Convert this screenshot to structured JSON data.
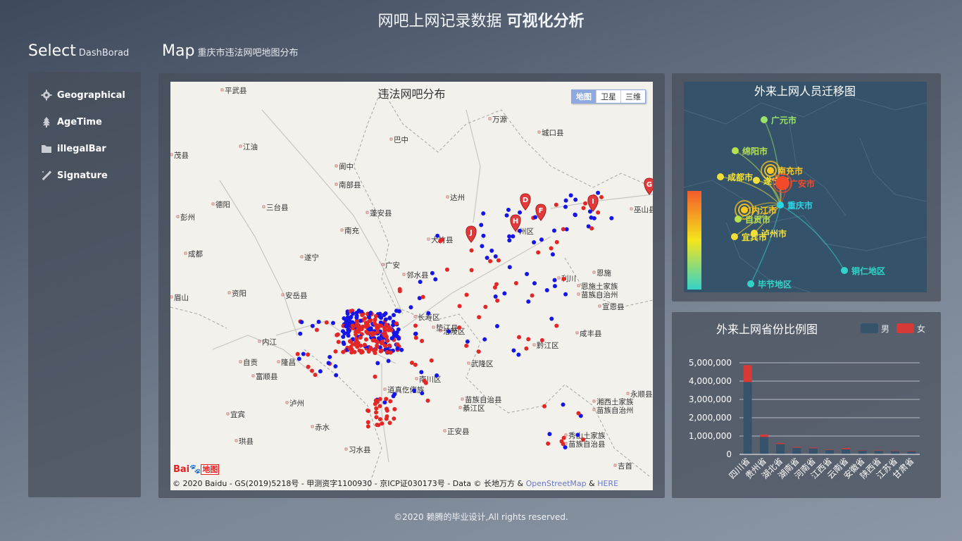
{
  "header": {
    "title_plain": "网吧上网记录数据",
    "title_bold": "可视化分析"
  },
  "sidebar": {
    "heading": "Select",
    "subheading": "DashBorad",
    "items": [
      {
        "label": "Geographical",
        "icon": "gear-icon"
      },
      {
        "label": "AgeTime",
        "icon": "tree-icon"
      },
      {
        "label": "illegalBar",
        "icon": "folder-icon"
      },
      {
        "label": "Signature",
        "icon": "magic-wand-icon"
      }
    ]
  },
  "map_section": {
    "heading": "Map",
    "subheading": "重庆市违法网吧地图分布",
    "map_title": "违法网吧分布",
    "map_types": [
      "地图",
      "卫星",
      "三维"
    ],
    "active_type": "地图",
    "logo_text": "Bai",
    "logo_suffix": "地图",
    "copyright": "© 2020 Baidu - GS(2019)5218号 - 甲测资字1100930 - 京ICP证030173号 - Data © 长地万方 &",
    "link_osm": "OpenStreetMap",
    "amp": "&",
    "link_here": "HERE",
    "place_labels": [
      "平武县",
      "茂县",
      "江油",
      "巴中",
      "万源",
      "城口县",
      "阆中",
      "南部县",
      "德阳",
      "三台县",
      "达州",
      "彭州",
      "蓬安县",
      "南充",
      "大竹县",
      "成都",
      "遂宁",
      "广安",
      "邻水县",
      "利川",
      "恩施",
      "巫山县",
      "资阳",
      "安岳县",
      "恩施土家族",
      "苗族自治州",
      "眉山",
      "宣恩县",
      "长寿区",
      "垫江县",
      "涪陵区",
      "咸丰县",
      "内江",
      "黔江区",
      "自贡",
      "隆昌",
      "富顺县",
      "武隆区",
      "南川区",
      "道真仡佬族",
      "苗族自治县",
      "綦江区",
      "泸州",
      "永顺县",
      "湘西土家族",
      "苗族自治州",
      "宜宾",
      "赤水",
      "正安县",
      "珙县",
      "秀山土家族",
      "苗族自治县",
      "习水县",
      "吉首",
      "州区"
    ],
    "markers": [
      "D",
      "F",
      "H",
      "I",
      "J",
      "G"
    ],
    "legend_colors": {
      "blue": "#1515e6",
      "red": "#e32626"
    }
  },
  "migration": {
    "title": "外来上网人员迁移图",
    "cities": [
      "广元市",
      "绵阳市",
      "成都市",
      "南充市",
      "遂宁市",
      "广安市",
      "内江市",
      "重庆市",
      "自贡市",
      "泸州市",
      "宜宾市",
      "铜仁地区",
      "毕节地区"
    ]
  },
  "province_chart": {
    "title": "外来上网省份比例图",
    "legend": [
      "男",
      "女"
    ],
    "colors": {
      "male": "#35536a",
      "female": "#d73a36"
    }
  },
  "chart_data": {
    "type": "bar",
    "stacked": true,
    "categories": [
      "四川省",
      "贵州省",
      "湖北省",
      "湖南省",
      "河南省",
      "江西省",
      "云南省",
      "安徽省",
      "陕西省",
      "江苏省",
      "甘肃省"
    ],
    "series": [
      {
        "name": "男",
        "values": [
          3950000,
          950000,
          560000,
          360000,
          330000,
          240000,
          280000,
          210000,
          200000,
          180000,
          170000
        ]
      },
      {
        "name": "女",
        "values": [
          920000,
          130000,
          60000,
          40000,
          40000,
          20000,
          60000,
          20000,
          20000,
          20000,
          20000
        ]
      }
    ],
    "ylim": [
      0,
      5000000
    ],
    "yticks": [
      "0",
      "1,000,000",
      "2,000,000",
      "3,000,000",
      "4,000,000",
      "5,000,000"
    ],
    "grid": true,
    "legend_position": "top-right"
  },
  "footer": {
    "text": "©2020 赖腾的毕业设计,All rights reserved."
  }
}
